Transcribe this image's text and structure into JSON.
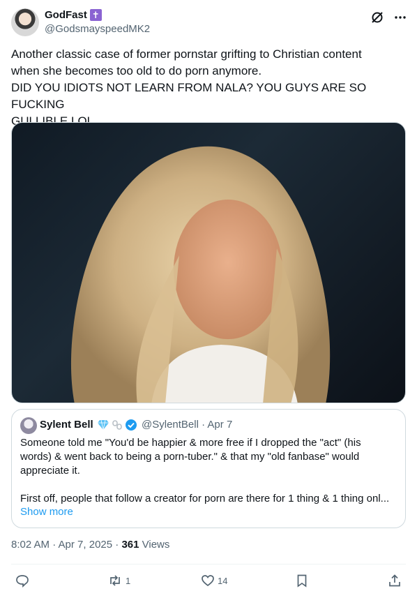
{
  "author": {
    "name": "GodFast",
    "badge": "✝",
    "handle": "@GodsmayspeedMK2"
  },
  "tweet": {
    "text": "Another classic case of former pornstar grifting to Christian content\nwhen she becomes too old to do porn anymore.\nDID YOU IDIOTS NOT LEARN FROM NALA? YOU GUYS ARE SO FUCKING\nGULLIBLE LOL"
  },
  "quote": {
    "name": "Sylent Bell",
    "handle": "@SylentBell · Apr 7",
    "text": "Someone told me \"You'd be happier & more free if I dropped the \"act\" (his\nwords) & went back to being a porn-tuber.\" & that my \"old fanbase\" would\nappreciate it.",
    "last_line": "First off, people that follow a creator for porn are there for 1 thing & 1 thing onl...",
    "show_more": "Show more"
  },
  "meta": {
    "time": "8:02 AM · Apr 7, 2025 · ",
    "views_count": "361",
    "views_label": " Views"
  },
  "actions": {
    "reposts": "1",
    "likes": "14"
  },
  "colors": {
    "link": "#1d9bf0",
    "muted": "#536471",
    "verified": "#1d9bf0"
  }
}
